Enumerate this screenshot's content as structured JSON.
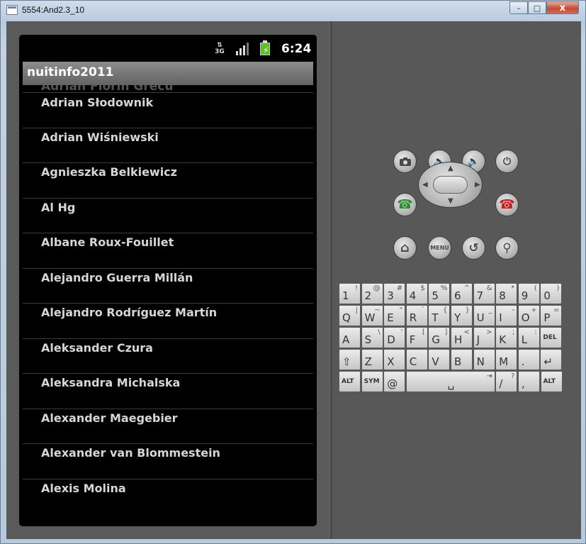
{
  "window": {
    "title": "5554:And2.3_10",
    "minimize_label": "–",
    "maximize_label": "□",
    "close_label": "x"
  },
  "status_bar": {
    "network": "3G",
    "time": "6:24",
    "battery": "charging"
  },
  "app": {
    "title": "nuitinfo2011",
    "ghost_item": "Adrian Florin Grecu",
    "items": [
      "Adrian Słodownik",
      "Adrian Wiśniewski",
      "Agnieszka Belkiewicz",
      "Al Hg",
      "Albane Roux-Fouillet",
      "Alejandro Guerra Millán",
      "Alejandro Rodríguez Martín",
      "Aleksander Czura",
      "Aleksandra Michalska",
      "Alexander Maegebier",
      "Alexander van Blommestein",
      "Alexis Molina"
    ]
  },
  "controls": {
    "camera_icon": "camera-icon",
    "vol_down": "🔈",
    "vol_up": "🔊",
    "power": "⏻",
    "call": "☎",
    "end_call": "☎",
    "home": "⌂",
    "menu_label": "MENU",
    "back": "↺",
    "search": "⚲"
  },
  "keyboard": {
    "rows": [
      [
        {
          "m": "1",
          "a": "!"
        },
        {
          "m": "2",
          "a": "@"
        },
        {
          "m": "3",
          "a": "#"
        },
        {
          "m": "4",
          "a": "$"
        },
        {
          "m": "5",
          "a": "%"
        },
        {
          "m": "6",
          "a": "^"
        },
        {
          "m": "7",
          "a": "&"
        },
        {
          "m": "8",
          "a": "*"
        },
        {
          "m": "9",
          "a": "("
        },
        {
          "m": "0",
          "a": ")"
        }
      ],
      [
        {
          "m": "Q",
          "a": "|"
        },
        {
          "m": "W",
          "a": "~"
        },
        {
          "m": "E",
          "a": "\""
        },
        {
          "m": "R",
          "a": "`"
        },
        {
          "m": "T",
          "a": "{"
        },
        {
          "m": "Y",
          "a": "}"
        },
        {
          "m": "U",
          "a": "_"
        },
        {
          "m": "I",
          "a": "-"
        },
        {
          "m": "O",
          "a": "+"
        },
        {
          "m": "P",
          "a": "="
        }
      ],
      [
        {
          "m": "A",
          "a": ""
        },
        {
          "m": "S",
          "a": "\\"
        },
        {
          "m": "D",
          "a": "'"
        },
        {
          "m": "F",
          "a": "["
        },
        {
          "m": "G",
          "a": "]"
        },
        {
          "m": "H",
          "a": "<"
        },
        {
          "m": "J",
          "a": ">"
        },
        {
          "m": "K",
          "a": ";"
        },
        {
          "m": "L",
          "a": ":"
        },
        {
          "m": "DEL",
          "a": ""
        }
      ],
      [
        {
          "m": "⇧",
          "a": ""
        },
        {
          "m": "Z",
          "a": ""
        },
        {
          "m": "X",
          "a": ""
        },
        {
          "m": "C",
          "a": ""
        },
        {
          "m": "V",
          "a": ""
        },
        {
          "m": "B",
          "a": ""
        },
        {
          "m": "N",
          "a": ""
        },
        {
          "m": "M",
          "a": ""
        },
        {
          "m": ".",
          "a": ""
        },
        {
          "m": "↵",
          "a": ""
        }
      ],
      [
        {
          "m": "ALT",
          "a": ""
        },
        {
          "m": "SYM",
          "a": ""
        },
        {
          "m": "@",
          "a": ""
        },
        {
          "m": "␣",
          "a": "⇥"
        },
        {
          "m": "/",
          "a": "?"
        },
        {
          "m": ",",
          "a": ""
        },
        {
          "m": "ALT",
          "a": ""
        }
      ]
    ]
  }
}
